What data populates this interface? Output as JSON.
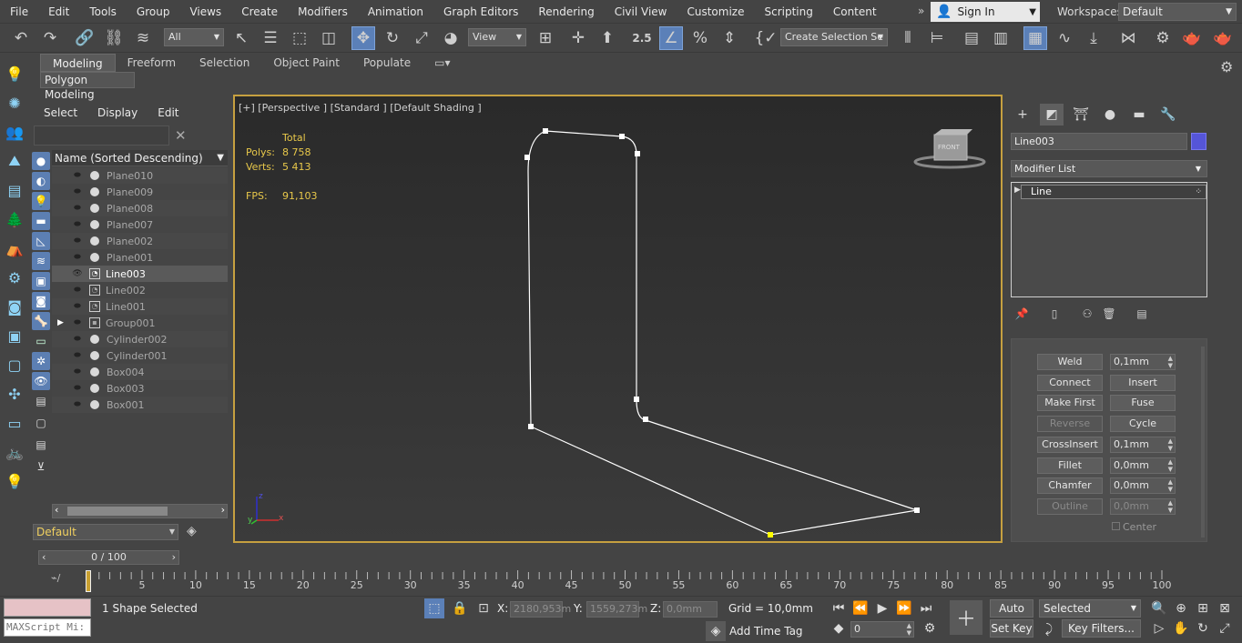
{
  "menubar": {
    "items": [
      "File",
      "Edit",
      "Tools",
      "Group",
      "Views",
      "Create",
      "Modifiers",
      "Animation",
      "Graph Editors",
      "Rendering",
      "Civil View",
      "Customize",
      "Scripting",
      "Content"
    ],
    "sign_in": "Sign In",
    "workspaces_label": "Workspaces:",
    "workspaces_value": "Default"
  },
  "toolbar": {
    "filter_select": "All",
    "ref_coord_select": "View",
    "selection_set": "Create Selection Se",
    "snap_value": "2.5"
  },
  "ribbon": {
    "tabs": [
      "Modeling",
      "Freeform",
      "Selection",
      "Object Paint",
      "Populate"
    ],
    "sub_label": "Polygon Modeling"
  },
  "scene_explorer": {
    "tabs": [
      "Select",
      "Display",
      "Edit"
    ],
    "header": "Name (Sorted Descending)",
    "items": [
      {
        "name": "Plane010",
        "type": "geo"
      },
      {
        "name": "Plane009",
        "type": "geo"
      },
      {
        "name": "Plane008",
        "type": "geo"
      },
      {
        "name": "Plane007",
        "type": "geo"
      },
      {
        "name": "Plane002",
        "type": "geo"
      },
      {
        "name": "Plane001",
        "type": "geo"
      },
      {
        "name": "Line003",
        "type": "shape",
        "selected": true
      },
      {
        "name": "Line002",
        "type": "shape"
      },
      {
        "name": "Line001",
        "type": "shape"
      },
      {
        "name": "Group001",
        "type": "group"
      },
      {
        "name": "Cylinder002",
        "type": "geo"
      },
      {
        "name": "Cylinder001",
        "type": "geo"
      },
      {
        "name": "Box004",
        "type": "geo"
      },
      {
        "name": "Box003",
        "type": "geo"
      },
      {
        "name": "Box001",
        "type": "geo"
      }
    ],
    "layer": "Default",
    "frame_slider": "0 / 100"
  },
  "viewport": {
    "label": "[+] [Perspective ] [Standard ] [Default Shading ]",
    "stats_total": "Total",
    "polys_label": "Polys:",
    "polys_value": "8 758",
    "verts_label": "Verts:",
    "verts_value": "5 413",
    "fps_label": "FPS:",
    "fps_value": "91,103",
    "viewcube_label": "FRONT"
  },
  "command_panel": {
    "object_name": "Line003",
    "object_color": "#5555d8",
    "modifier_list": "Modifier List",
    "stack_item": "Line",
    "buttons": {
      "weld": "Weld",
      "weld_value": "0,1mm",
      "connect": "Connect",
      "insert": "Insert",
      "make_first": "Make First",
      "fuse": "Fuse",
      "reverse": "Reverse",
      "cycle": "Cycle",
      "crossinsert": "CrossInsert",
      "crossinsert_value": "0,1mm",
      "fillet": "Fillet",
      "fillet_value": "0,0mm",
      "chamfer": "Chamfer",
      "chamfer_value": "0,0mm",
      "outline": "Outline",
      "outline_value": "0,0mm",
      "center": "Center"
    }
  },
  "timeline": {
    "ticks": [
      "0",
      "5",
      "10",
      "15",
      "20",
      "25",
      "30",
      "35",
      "40",
      "45",
      "50",
      "55",
      "60",
      "65",
      "70",
      "75",
      "80",
      "85",
      "90",
      "95",
      "100"
    ]
  },
  "status_bar": {
    "maxscript_placeholder": "MAXScript Mi:",
    "selection_status": "1 Shape Selected",
    "x_label": "X:",
    "x_value": "2180,953m",
    "y_label": "Y:",
    "y_value": "1559,273m",
    "z_label": "Z:",
    "z_value": "0,0mm",
    "grid": "Grid = 10,0mm",
    "add_time_tag": "Add Time Tag",
    "auto_key": "Auto Key",
    "set_key": "Set Key",
    "key_mode_select": "Selected",
    "key_filters": "Key Filters...",
    "current_frame": "0"
  }
}
